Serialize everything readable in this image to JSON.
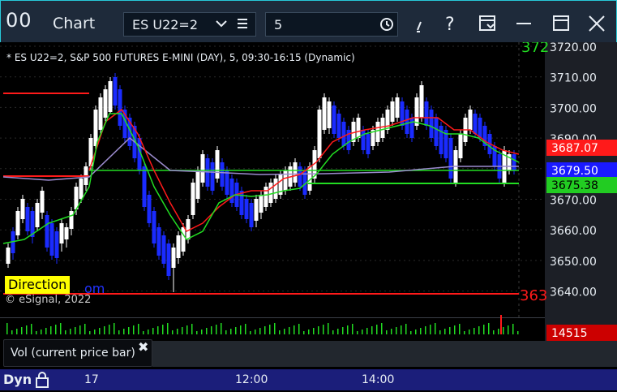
{
  "titlebar": {
    "app_icon_text": "00",
    "title": "Chart",
    "symbol": "ES U22=2",
    "interval": "5",
    "icons": [
      "chevron-down-icon",
      "list-icon",
      "clock-icon",
      "draw-icon",
      "help-icon",
      "layout-icon",
      "maximize-icon",
      "close-icon"
    ]
  },
  "chart": {
    "study_line": "* ES U22=2, S&P 500 FUTURES E-MINI (DAY), 5, 09:30-16:15 (Dynamic)",
    "copyright": "© eSignal, 2022",
    "direction_label": "Direction",
    "direction_suffix": "om",
    "price_ticks": [
      "3720.00",
      "3710.00",
      "3700.00",
      "3690.00",
      "3680.00",
      "3670.00",
      "3660.00",
      "3650.00",
      "3640.00"
    ],
    "badges": {
      "last_price": "3687.07",
      "mid_price": "3679.50",
      "green_level": "3675.38",
      "volume": "14515",
      "top_edge": "372",
      "bottom_edge": "363"
    },
    "colors": {
      "up_candle": "#ffffff",
      "down_candle": "#1a2bff",
      "red_line": "#ff1a1a",
      "green_line": "#22dd22",
      "purple_line": "#9c8ccf",
      "accent": "#27c8d8"
    }
  },
  "volume_pane": {
    "tooltip": "Vol (current price bar)",
    "close_glyph": "✖"
  },
  "footer": {
    "mode": "Dyn",
    "times": [
      "17",
      "12:00",
      "14:00"
    ]
  }
}
